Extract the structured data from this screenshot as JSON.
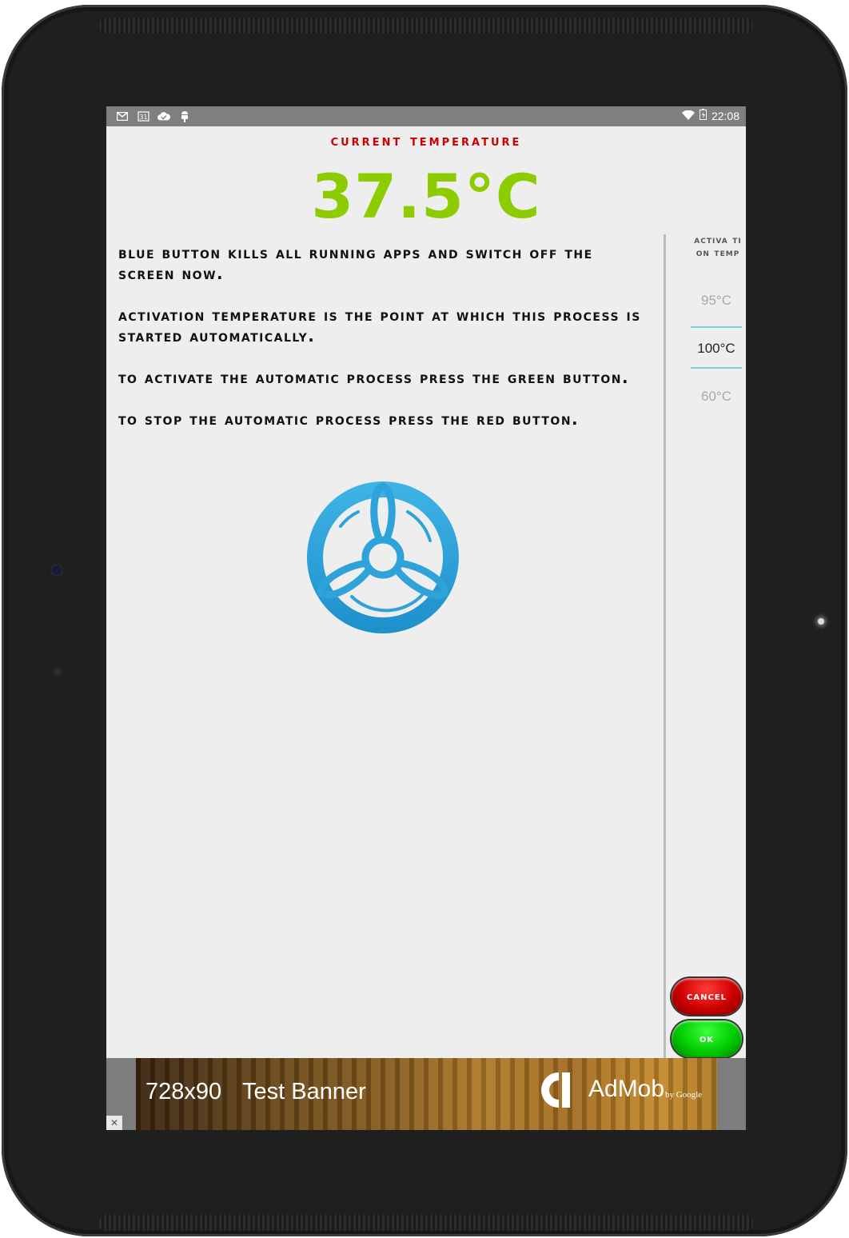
{
  "statusbar": {
    "icons": [
      "gmail-icon",
      "calendar-icon",
      "cloud-check-icon",
      "android-debug-icon"
    ],
    "time": "22:08"
  },
  "title": "Current Temperature",
  "temperature": "37.5°C",
  "info": {
    "p1": "Blue button kills all running apps and switch off the screen now.",
    "p2": "Activation Temperature is the point at which this process is started automatically.",
    "p3": "To activate the automatic process press the Green button.",
    "p4": "To stop the automatic process press the Red button."
  },
  "picker": {
    "label": "activa tion temp",
    "above": "95°C",
    "selected": "100°C",
    "below": "60°C"
  },
  "buttons": {
    "cancel": "Cancel",
    "ok": "OK"
  },
  "ad": {
    "size": "728x90",
    "text": "Test Banner",
    "brand": "AdMob",
    "by": "by Google",
    "close": "✕"
  },
  "colors": {
    "title": "#cc0000",
    "temperature": "#8ccc00",
    "fan": "#2ea3da",
    "cancel": "#cc0000",
    "ok": "#00cc00"
  }
}
